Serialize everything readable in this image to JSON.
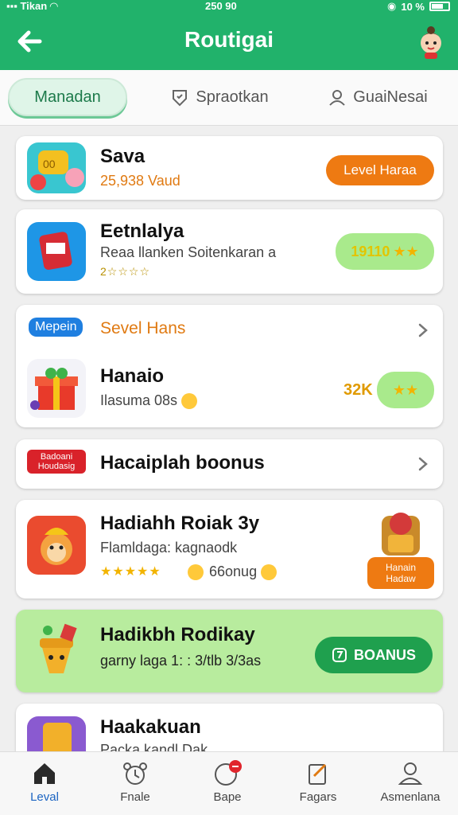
{
  "status": {
    "carrier": "Tikan",
    "time": "250 90",
    "battery": "10 %"
  },
  "header": {
    "title": "Routigai"
  },
  "tabs": [
    {
      "label": "Manadan",
      "active": true
    },
    {
      "label": "Spraotkan",
      "active": false
    },
    {
      "label": "GuaiNesai",
      "active": false
    }
  ],
  "cards": {
    "c1": {
      "title": "Sava",
      "sub": "25,938 Vaud",
      "action": "Level Haraa"
    },
    "c2": {
      "title": "Eetnlalya",
      "sub": "Reaa llanken Soitenkaran a",
      "rating": "2☆☆☆☆",
      "pill": "19110"
    },
    "c3": {
      "badge": "Mepein",
      "header": "Sevel Hans",
      "title": "Hanaio",
      "sub": "Ilasuma 08s",
      "value": "32K"
    },
    "c4": {
      "badge_line1": "Badoani",
      "badge_line2": "Houdasig",
      "title": "Hacaiplah boonus"
    },
    "c5": {
      "title": "Hadiahh Roiak 3y",
      "sub": "Flamldaga: kagnaodk",
      "stars": "★★★★★",
      "extra": "66onug",
      "reward_line1": "Hanain",
      "reward_line2": "Hadaw"
    },
    "c6": {
      "title": "Hadikbh Rodikay",
      "sub": "garny laga 1: : 3/tlb 3/3as",
      "button": "BOANUS"
    },
    "c7": {
      "title": "Haakakuan",
      "sub": "Packa kandl Dak"
    }
  },
  "nav": [
    {
      "label": "Leval",
      "active": true
    },
    {
      "label": "Fnale",
      "active": false
    },
    {
      "label": "Bape",
      "active": false,
      "badge": ""
    },
    {
      "label": "Fagars",
      "active": false
    },
    {
      "label": "Asmenlana",
      "active": false
    }
  ],
  "colors": {
    "primary": "#21b26b",
    "accent": "#ee7a12",
    "highlight": "#b8ec9e"
  }
}
